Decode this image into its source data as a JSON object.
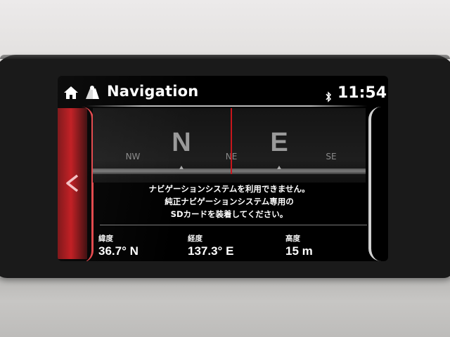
{
  "header": {
    "title": "Navigation",
    "time": "11:54",
    "home_icon": "home-icon",
    "nav_icon": "map-navigation-icon",
    "bluetooth_icon": "bluetooth-icon"
  },
  "compass": {
    "cardinals": [
      "N",
      "E"
    ],
    "intercardinals": [
      "NW",
      "NE",
      "SE"
    ],
    "needle_color": "#c8161c"
  },
  "message": {
    "lines": [
      "ナビゲーションシステムを利用できません。",
      "純正ナビゲーションシステム専用の",
      "SDカードを装着してください。"
    ]
  },
  "readouts": {
    "latitude": {
      "label": "緯度",
      "value": "36.7° N"
    },
    "longitude": {
      "label": "経度",
      "value": "137.3° E"
    },
    "altitude": {
      "label": "高度",
      "value": "15 m"
    }
  },
  "colors": {
    "accent_red": "#c0181d",
    "background": "#000000",
    "text": "#ffffff"
  }
}
